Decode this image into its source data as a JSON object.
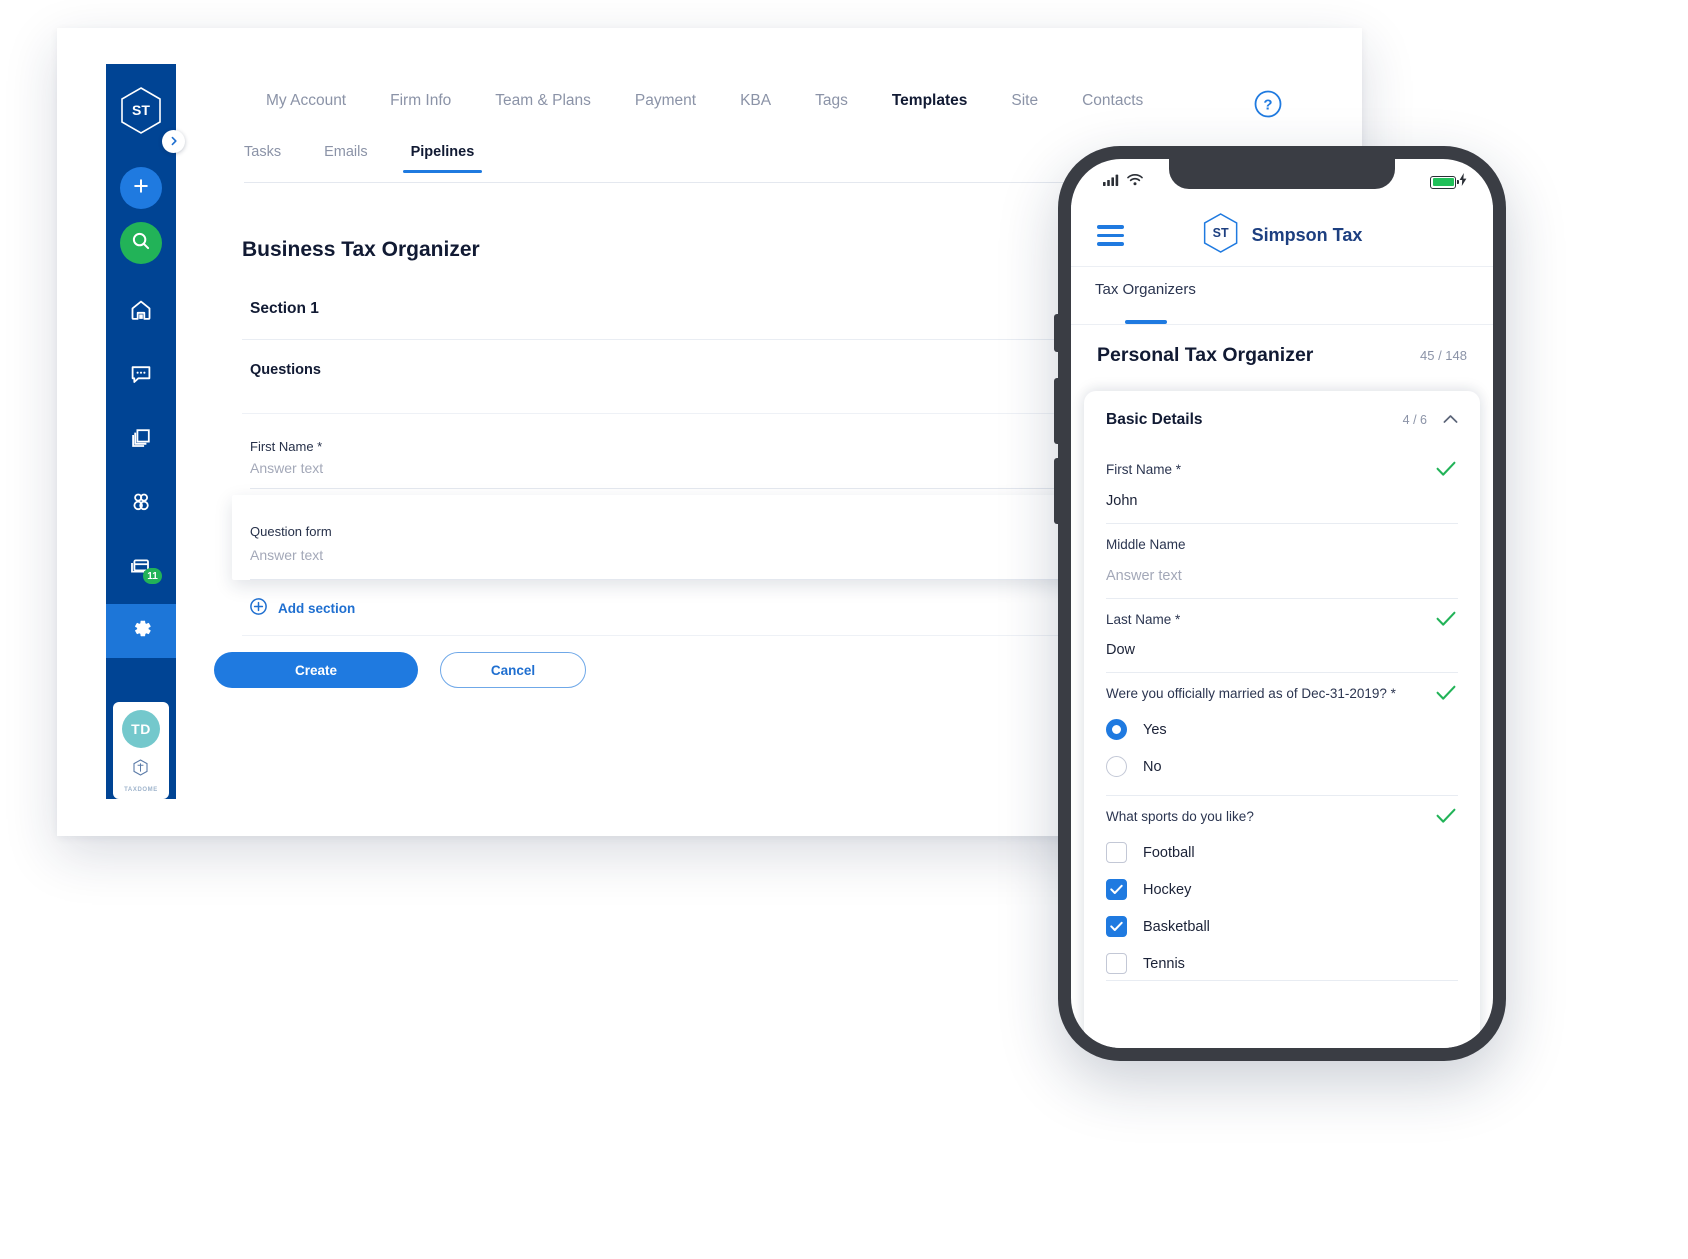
{
  "desktop": {
    "topnav": [
      {
        "label": "My Account",
        "active": false
      },
      {
        "label": "Firm Info",
        "active": false
      },
      {
        "label": "Team & Plans",
        "active": false
      },
      {
        "label": "Payment",
        "active": false
      },
      {
        "label": "KBA",
        "active": false
      },
      {
        "label": "Tags",
        "active": false
      },
      {
        "label": "Templates",
        "active": true
      },
      {
        "label": "Site",
        "active": false
      },
      {
        "label": "Contacts",
        "active": false
      }
    ],
    "subtabs": [
      {
        "label": "Tasks",
        "active": false
      },
      {
        "label": "Emails",
        "active": false
      },
      {
        "label": "Pipelines",
        "active": true
      }
    ],
    "help_icon": "help-circle-icon",
    "page_title": "Business Tax Organizer",
    "section_title": "Section 1",
    "questions_label": "Questions",
    "questions": [
      {
        "label": "First Name *",
        "answer_placeholder": "Answer text"
      },
      {
        "label": "Question form",
        "answer_placeholder": "Answer text"
      }
    ],
    "add_section_label": "Add section",
    "add_section_icon": "plus-circle-icon",
    "buttons": {
      "create": "Create",
      "cancel": "Cancel"
    },
    "rail": {
      "logo_text": "ST",
      "expand_icon": "chevron-right-icon",
      "add_icon": "plus-icon",
      "search_icon": "search-icon",
      "items": [
        {
          "icon": "home-icon",
          "name": "home",
          "badge": null
        },
        {
          "icon": "chat-icon",
          "name": "chats",
          "badge": null
        },
        {
          "icon": "documents-icon",
          "name": "documents",
          "badge": null
        },
        {
          "icon": "contacts-icon",
          "name": "contacts",
          "badge": null
        },
        {
          "icon": "billing-icon",
          "name": "billing",
          "badge": "11"
        },
        {
          "icon": "gear-icon",
          "name": "settings",
          "badge": null
        }
      ],
      "user_initials": "TD",
      "brand_word": "TAXDOME"
    }
  },
  "phone": {
    "status": {
      "signal_icon": "cellular-signal-icon",
      "wifi_icon": "wifi-icon",
      "battery_icon": "battery-charging-icon"
    },
    "menu_icon": "hamburger-menu-icon",
    "brand_logo_text": "ST",
    "brand_name": "Simpson Tax",
    "tab_label": "Tax Organizers",
    "organizer_title": "Personal Tax Organizer",
    "organizer_count": "45 / 148",
    "card": {
      "title": "Basic Details",
      "count": "4 / 6",
      "collapse_icon": "chevron-up-icon",
      "fields": [
        {
          "type": "text",
          "label": "First Name *",
          "value": "John",
          "placeholder": false,
          "completed": true
        },
        {
          "type": "text",
          "label": "Middle Name",
          "value": "Answer text",
          "placeholder": true,
          "completed": false
        },
        {
          "type": "text",
          "label": "Last Name *",
          "value": "Dow",
          "placeholder": false,
          "completed": true
        },
        {
          "type": "radio",
          "label": "Were you officially married as of Dec-31-2019? *",
          "completed": true,
          "options": [
            {
              "label": "Yes",
              "selected": true
            },
            {
              "label": "No",
              "selected": false
            }
          ]
        },
        {
          "type": "checkbox",
          "label": "What sports do you like?",
          "completed": true,
          "options": [
            {
              "label": "Football",
              "selected": false
            },
            {
              "label": "Hockey",
              "selected": true
            },
            {
              "label": "Basketball",
              "selected": true
            },
            {
              "label": "Tennis",
              "selected": false
            }
          ]
        }
      ]
    }
  },
  "colors": {
    "brand_blue": "#1f7ae0",
    "rail_blue": "#004494",
    "green": "#22b358",
    "check_green": "#22b358",
    "avatar_teal": "#74c8cc"
  }
}
